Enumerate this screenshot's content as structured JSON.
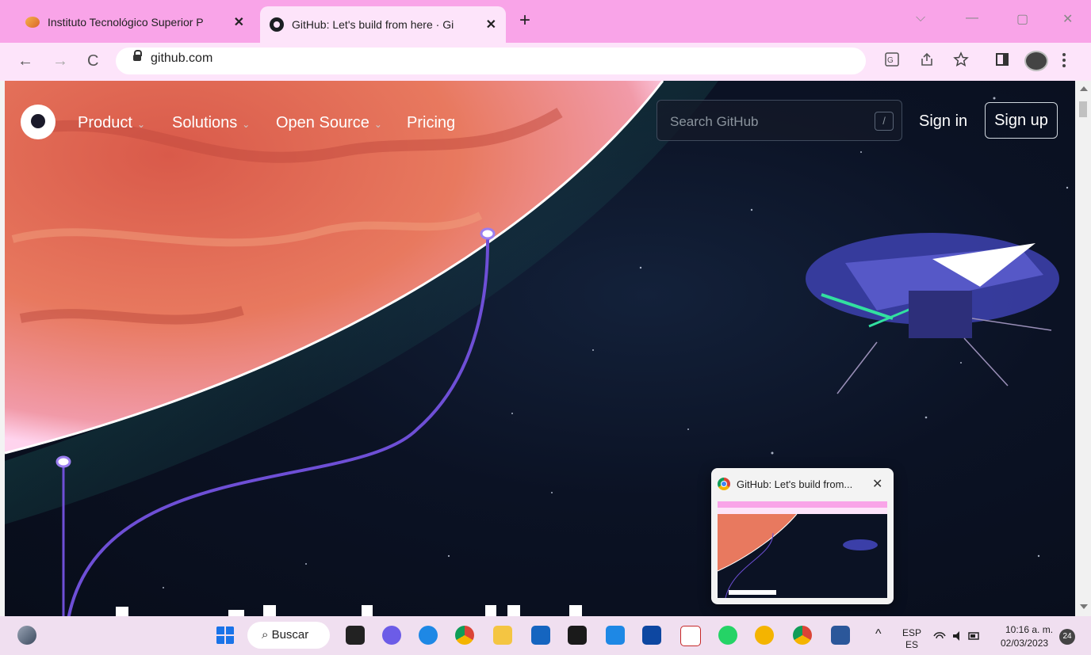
{
  "browser": {
    "tabs": [
      {
        "title": "Instituto Tecnológico Superior P",
        "close": "✕",
        "active": false
      },
      {
        "title": "GitHub: Let's build from here · Gi",
        "close": "✕",
        "active": true
      }
    ],
    "new_tab": "+",
    "window_controls": {
      "minimize": "—",
      "restore": "▢",
      "close": "✕",
      "dropdown": "⌵"
    },
    "nav": {
      "back": "←",
      "forward": "→",
      "reload": "C"
    },
    "url": "github.com",
    "toolbar_icons": [
      "translate-icon",
      "share-icon",
      "star-icon",
      "side-panel-icon",
      "profile-avatar",
      "menu-icon"
    ]
  },
  "site": {
    "nav": [
      {
        "label": "Product",
        "chevron": "⌄"
      },
      {
        "label": "Solutions",
        "chevron": "⌄"
      },
      {
        "label": "Open Source",
        "chevron": "⌄"
      },
      {
        "label": "Pricing",
        "chevron": ""
      }
    ],
    "search": {
      "placeholder": "Search GitHub",
      "shortcut": "/"
    },
    "sign_in": "Sign in",
    "sign_up": "Sign up"
  },
  "preview_popup": {
    "title": "GitHub: Let's build from...",
    "close": "✕"
  },
  "taskbar": {
    "search_label": "Buscar",
    "tray": {
      "chevron": "^",
      "lang_top": "ESP",
      "lang_bottom": "ES",
      "time": "10:16 a. m.",
      "date": "02/03/2023",
      "notifications": "24"
    }
  },
  "colors": {
    "tab_strip": "#f9a4e8",
    "toolbar": "#fde4fa",
    "page_bg": "#0b1224",
    "planet": "#e8705a",
    "arc": "#6e4fd6"
  }
}
